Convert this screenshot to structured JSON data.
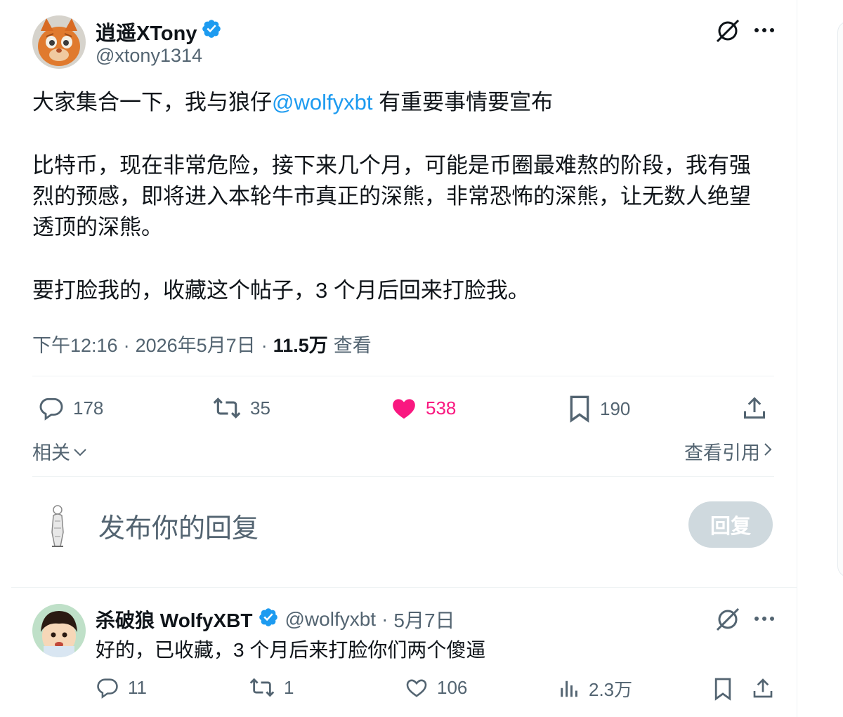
{
  "main_tweet": {
    "author_name": "逍遥XTony",
    "author_handle": "@xtony1314",
    "text_prefix": "大家集合一下，我与狼仔",
    "mention": "@wolfyxbt",
    "text_suffix": " 有重要事情要宣布",
    "paragraph2_line1": "比特币，现在非常危险，接下来几个月，可能是币圈最难熬的阶段，我有强",
    "paragraph2_line2": "烈的预感，即将进入本轮牛市真正的深熊，非常恐怖的深熊，让无数人绝望",
    "paragraph2_line3": "透顶的深熊。",
    "paragraph3": "要打脸我的，收藏这个帖子，3 个月后回来打脸我。",
    "time": "下午12:16",
    "date": "2026年5月7日",
    "views_count": "11.5万",
    "views_label": "查看",
    "sep": "·",
    "stats": {
      "replies": "178",
      "retweets": "35",
      "likes": "538",
      "bookmarks": "190"
    },
    "related_label": "相关",
    "view_quotes_label": "查看引用"
  },
  "reply_box": {
    "placeholder": "发布你的回复",
    "button_label": "回复"
  },
  "reply_tweet": {
    "author_name": "杀破狼 WolfyXBT",
    "author_handle": "@wolfyxbt",
    "sep": "·",
    "date": "5月7日",
    "text": "好的，已收藏，3 个月后来打脸你们两个傻逼",
    "stats": {
      "replies": "11",
      "retweets": "1",
      "likes": "106",
      "views": "2.3万"
    }
  },
  "colors": {
    "accent": "#1d9bf0",
    "like": "#f91880",
    "muted": "#536471",
    "text": "#0f1419",
    "button_disabled": "#cfd9de"
  },
  "icons": [
    "verified-badge-icon",
    "grok-icon",
    "more-icon",
    "reply-icon",
    "retweet-icon",
    "heart-icon",
    "bookmark-icon",
    "share-icon",
    "chevron-down-icon",
    "chevron-right-icon",
    "views-icon"
  ]
}
